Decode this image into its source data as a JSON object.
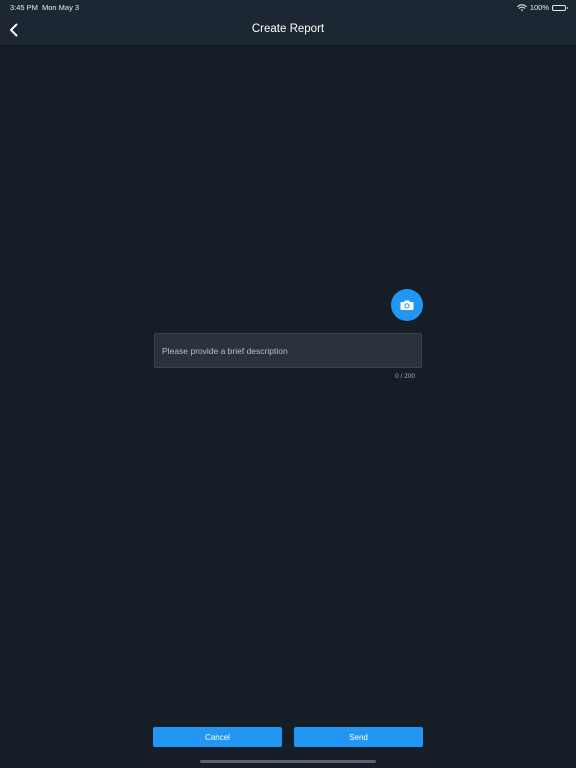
{
  "status_bar": {
    "time": "3:45 PM",
    "date": "Mon May 3",
    "battery": "100%",
    "wifi_icon": "wifi-icon",
    "battery_icon": "battery-icon"
  },
  "nav": {
    "title": "Create Report",
    "back_icon": "chevron-left-icon"
  },
  "report": {
    "camera_icon": "camera-icon",
    "description_placeholder": "Please provide a brief description",
    "description_value": "",
    "char_count": "0 / 200"
  },
  "actions": {
    "cancel_label": "Cancel",
    "send_label": "Send"
  },
  "colors": {
    "background": "#151d26",
    "nav_background": "#1d2733",
    "accent": "#2196f3",
    "input_background": "#2a323b"
  }
}
